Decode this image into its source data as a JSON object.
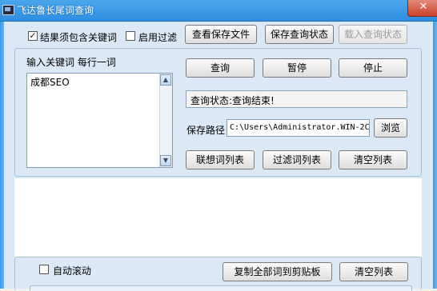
{
  "window": {
    "title": "飞达鲁长尾词查询",
    "close_glyph": "✕"
  },
  "options": {
    "must_contain_keyword": {
      "label": "结果须包含关键词",
      "checked": true
    },
    "enable_filter": {
      "label": "启用过滤",
      "checked": false
    }
  },
  "top_buttons": {
    "view_saved_file": "查看保存文件",
    "save_query_state": "保存查询状态",
    "load_query_state": "载入查询状态"
  },
  "input": {
    "label": "输入关键词 每行一词",
    "keywords_text": "成都SEO"
  },
  "controls": {
    "query": "查询",
    "pause": "暂停",
    "stop": "停止"
  },
  "status": {
    "text": "查询状态:查询结束!"
  },
  "save_path": {
    "label": "保存路径",
    "value": "C:\\Users\\Administrator.WIN-2C",
    "browse": "浏览"
  },
  "list_buttons": {
    "related_words": "联想词列表",
    "filter_words": "过滤词列表",
    "clear_list": "清空列表"
  },
  "bottom": {
    "auto_scroll": {
      "label": "自动滚动",
      "checked": false
    },
    "copy_all": "复制全部词到剪贴板",
    "clear_list": "清空列表"
  },
  "icons": [
    "app-icon",
    "close-icon",
    "check-icon",
    "scroll-up-icon",
    "scroll-down-icon"
  ]
}
